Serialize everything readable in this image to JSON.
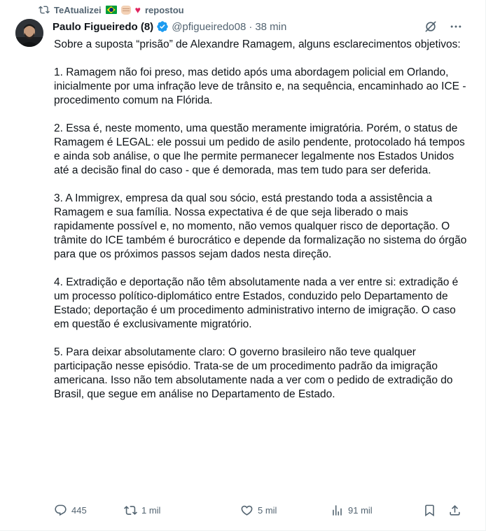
{
  "repost": {
    "user": "TeAtualizei",
    "label": "repostou",
    "emoji": [
      "brazil-flag",
      "fist",
      "red-heart"
    ]
  },
  "post": {
    "name": "Paulo Figueiredo (8)",
    "handle": "@pfigueiredo08",
    "separator": "·",
    "time": "38 min",
    "paragraphs": [
      "Sobre a suposta “prisão” de Alexandre Ramagem, alguns esclarecimentos objetivos:",
      "1. Ramagem não foi preso, mas detido após uma abordagem policial em Orlando, inicialmente por uma infração leve de trânsito e, na sequência, encaminhado ao ICE - procedimento comum na Flórida.",
      "2. Essa é, neste momento, uma questão meramente imigratória. Porém, o status de Ramagem é LEGAL: ele possui um pedido de asilo pendente, protocolado há tempos e ainda sob análise, o que lhe permite permanecer legalmente nos Estados Unidos até a decisão final do caso - que é demorada, mas tem tudo para ser deferida.",
      "3. A Immigrex, empresa da qual sou sócio, está prestando toda a assistência a Ramagem e sua família. Nossa expectativa é de que seja liberado o mais rapidamente possível e, no momento, não vemos qualquer risco de deportação. O trâmite do ICE também é burocrático e depende da formalização no sistema do órgão para que os próximos passos sejam dados nesta direção.",
      "4. Extradição e deportação não têm absolutamente nada a ver entre si: extradição é um processo político-diplomático entre Estados, conduzido pelo Departamento de Estado; deportação é um procedimento administrativo interno de imigração. O caso em questão é exclusivamente migratório.",
      "5. Para deixar absolutamente claro: O governo brasileiro não teve qualquer participação nesse episódio. Trata-se de um procedimento padrão da imigração americana. Isso não tem absolutamente nada a ver com o pedido de extradição do Brasil, que segue em análise no Departamento de Estado."
    ]
  },
  "stats": {
    "replies": "445",
    "reposts": "1 mil",
    "likes": "5 mil",
    "views": "91 mil"
  },
  "icons": {
    "repost": "repost-icon",
    "verified": "verified-badge-icon",
    "grok": "grok-icon",
    "more": "more-icon",
    "reply": "reply-icon",
    "like": "heart-icon",
    "views": "views-icon",
    "bookmark": "bookmark-icon",
    "share": "share-icon"
  },
  "colors": {
    "text": "#0f1419",
    "secondary": "#536471",
    "verified": "#1d9bf0"
  }
}
